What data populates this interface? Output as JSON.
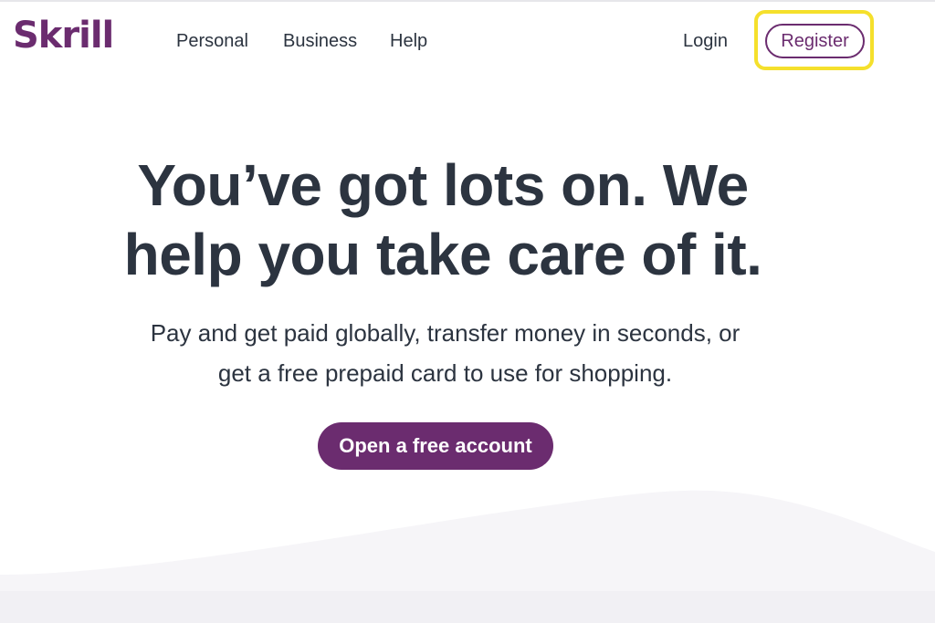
{
  "brand": {
    "logo_text": "Skrill",
    "brand_color": "#6b2c6f",
    "highlight_color": "#f5e02c",
    "text_color": "#2c3440"
  },
  "nav": {
    "personal": "Personal",
    "business": "Business",
    "help": "Help",
    "login": "Login",
    "register": "Register"
  },
  "hero": {
    "title_line1": "You’ve got lots on. We",
    "title_line2": "help you take care of it.",
    "subtitle_line1": "Pay and get paid globally, transfer money in seconds, or",
    "subtitle_line2": "get a free prepaid card to use for shopping.",
    "cta": "Open a free account"
  }
}
